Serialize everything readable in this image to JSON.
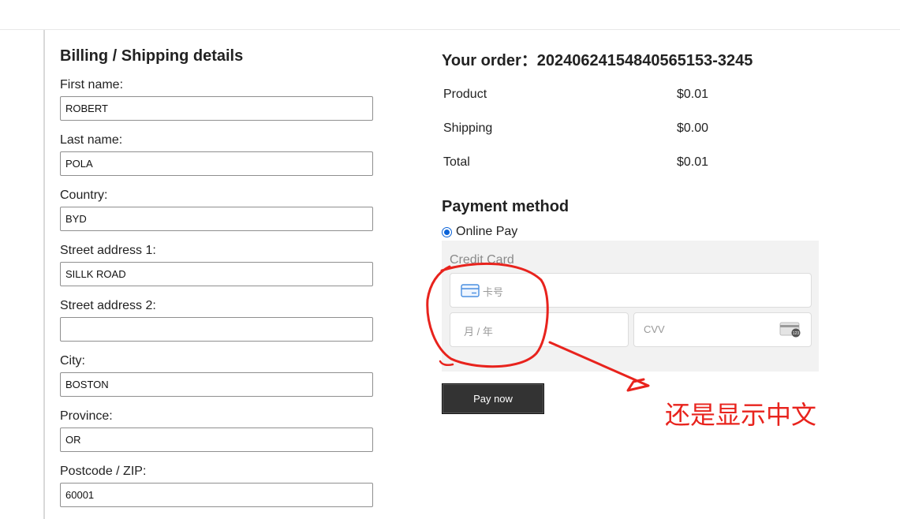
{
  "billing": {
    "title": "Billing / Shipping details",
    "fields": [
      {
        "label": "First name:",
        "value": "ROBERT"
      },
      {
        "label": "Last name:",
        "value": "POLA"
      },
      {
        "label": "Country:",
        "value": "BYD"
      },
      {
        "label": "Street address 1:",
        "value": "SILLK ROAD"
      },
      {
        "label": "Street address 2:",
        "value": ""
      },
      {
        "label": "City:",
        "value": "BOSTON"
      },
      {
        "label": "Province:",
        "value": "OR"
      },
      {
        "label": "Postcode / ZIP:",
        "value": "60001"
      }
    ]
  },
  "order": {
    "title": "Your order：20240624154840565153-3245",
    "rows": [
      {
        "name": "Product",
        "amount": "$0.01"
      },
      {
        "name": "Shipping",
        "amount": "$0.00"
      },
      {
        "name": "Total",
        "amount": "$0.01"
      }
    ]
  },
  "payment": {
    "title": "Payment method",
    "option_label": "Online Pay",
    "card_title": "Credit Card",
    "card_number_placeholder": "卡号",
    "expiry_placeholder": "月 / 年",
    "cvv_placeholder": "CVV",
    "cvv_icon_text": "123",
    "pay_button": "Pay now"
  },
  "annotation": {
    "text": "还是显示中文",
    "color": "#e8231d"
  },
  "colors": {
    "accent": "#0b63d8",
    "button_bg": "#333333"
  }
}
